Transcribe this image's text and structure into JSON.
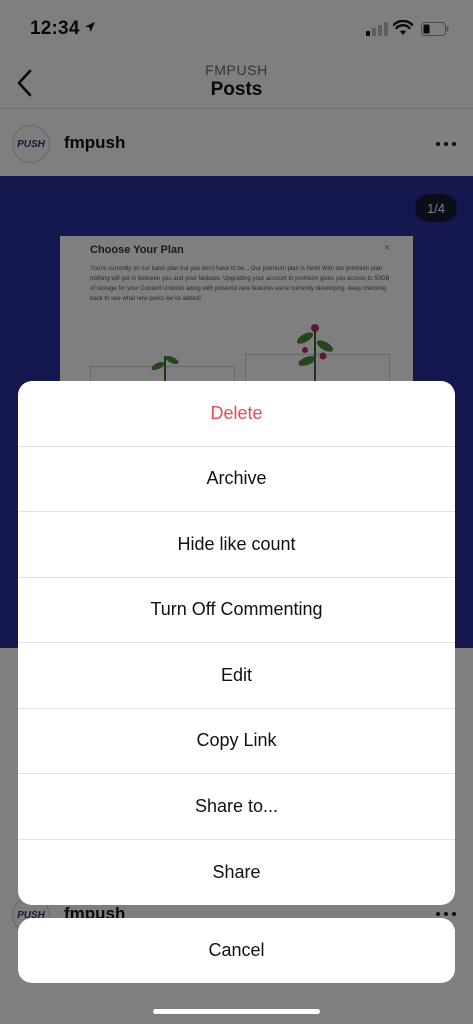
{
  "status_bar": {
    "time": "12:34",
    "icons": [
      "location-arrow-icon",
      "cellular-signal-icon",
      "wifi-icon",
      "battery-icon"
    ]
  },
  "nav": {
    "subtitle": "FMPUSH",
    "title": "Posts",
    "back_icon": "chevron-left-icon"
  },
  "post": {
    "avatar_text": "PUSH",
    "username": "fmpush",
    "more_icon": "ellipsis-icon",
    "page_indicator": "1/4",
    "media_background": "#2a2f9e",
    "card": {
      "title": "Choose Your Plan",
      "close": "×",
      "body": "You're currently on our basic plan but you don't have to be... Our premium plan is here! With our premium plan nothing will get in between you and your fanbase. Upgrading your account to premium gives you access to 50GB of storage for your Content Unlocks along with powerful new features we're currently developing, keep checking back to see what new perks we've added!"
    }
  },
  "next_post": {
    "avatar_text": "PUSH",
    "username": "fmpush"
  },
  "action_sheet": {
    "items": [
      {
        "label": "Delete",
        "style": "destructive"
      },
      {
        "label": "Archive"
      },
      {
        "label": "Hide like count"
      },
      {
        "label": "Turn Off Commenting"
      },
      {
        "label": "Edit"
      },
      {
        "label": "Copy Link"
      },
      {
        "label": "Share to..."
      },
      {
        "label": "Share"
      }
    ],
    "cancel_label": "Cancel",
    "destructive_color": "#ed4956"
  }
}
